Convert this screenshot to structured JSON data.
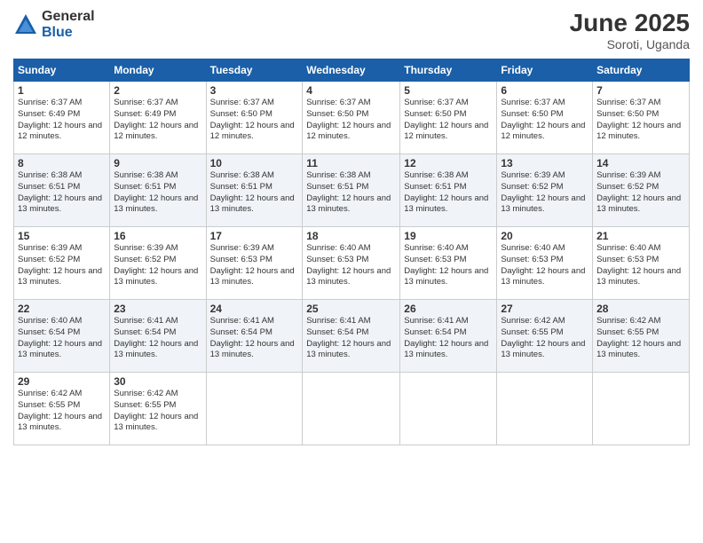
{
  "logo": {
    "general": "General",
    "blue": "Blue"
  },
  "title": {
    "month_year": "June 2025",
    "location": "Soroti, Uganda"
  },
  "weekdays": [
    "Sunday",
    "Monday",
    "Tuesday",
    "Wednesday",
    "Thursday",
    "Friday",
    "Saturday"
  ],
  "weeks": [
    [
      {
        "day": "1",
        "sunrise": "6:37 AM",
        "sunset": "6:49 PM",
        "daylight": "12 hours and 12 minutes."
      },
      {
        "day": "2",
        "sunrise": "6:37 AM",
        "sunset": "6:49 PM",
        "daylight": "12 hours and 12 minutes."
      },
      {
        "day": "3",
        "sunrise": "6:37 AM",
        "sunset": "6:50 PM",
        "daylight": "12 hours and 12 minutes."
      },
      {
        "day": "4",
        "sunrise": "6:37 AM",
        "sunset": "6:50 PM",
        "daylight": "12 hours and 12 minutes."
      },
      {
        "day": "5",
        "sunrise": "6:37 AM",
        "sunset": "6:50 PM",
        "daylight": "12 hours and 12 minutes."
      },
      {
        "day": "6",
        "sunrise": "6:37 AM",
        "sunset": "6:50 PM",
        "daylight": "12 hours and 12 minutes."
      },
      {
        "day": "7",
        "sunrise": "6:37 AM",
        "sunset": "6:50 PM",
        "daylight": "12 hours and 12 minutes."
      }
    ],
    [
      {
        "day": "8",
        "sunrise": "6:38 AM",
        "sunset": "6:51 PM",
        "daylight": "12 hours and 13 minutes."
      },
      {
        "day": "9",
        "sunrise": "6:38 AM",
        "sunset": "6:51 PM",
        "daylight": "12 hours and 13 minutes."
      },
      {
        "day": "10",
        "sunrise": "6:38 AM",
        "sunset": "6:51 PM",
        "daylight": "12 hours and 13 minutes."
      },
      {
        "day": "11",
        "sunrise": "6:38 AM",
        "sunset": "6:51 PM",
        "daylight": "12 hours and 13 minutes."
      },
      {
        "day": "12",
        "sunrise": "6:38 AM",
        "sunset": "6:51 PM",
        "daylight": "12 hours and 13 minutes."
      },
      {
        "day": "13",
        "sunrise": "6:39 AM",
        "sunset": "6:52 PM",
        "daylight": "12 hours and 13 minutes."
      },
      {
        "day": "14",
        "sunrise": "6:39 AM",
        "sunset": "6:52 PM",
        "daylight": "12 hours and 13 minutes."
      }
    ],
    [
      {
        "day": "15",
        "sunrise": "6:39 AM",
        "sunset": "6:52 PM",
        "daylight": "12 hours and 13 minutes."
      },
      {
        "day": "16",
        "sunrise": "6:39 AM",
        "sunset": "6:52 PM",
        "daylight": "12 hours and 13 minutes."
      },
      {
        "day": "17",
        "sunrise": "6:39 AM",
        "sunset": "6:53 PM",
        "daylight": "12 hours and 13 minutes."
      },
      {
        "day": "18",
        "sunrise": "6:40 AM",
        "sunset": "6:53 PM",
        "daylight": "12 hours and 13 minutes."
      },
      {
        "day": "19",
        "sunrise": "6:40 AM",
        "sunset": "6:53 PM",
        "daylight": "12 hours and 13 minutes."
      },
      {
        "day": "20",
        "sunrise": "6:40 AM",
        "sunset": "6:53 PM",
        "daylight": "12 hours and 13 minutes."
      },
      {
        "day": "21",
        "sunrise": "6:40 AM",
        "sunset": "6:53 PM",
        "daylight": "12 hours and 13 minutes."
      }
    ],
    [
      {
        "day": "22",
        "sunrise": "6:40 AM",
        "sunset": "6:54 PM",
        "daylight": "12 hours and 13 minutes."
      },
      {
        "day": "23",
        "sunrise": "6:41 AM",
        "sunset": "6:54 PM",
        "daylight": "12 hours and 13 minutes."
      },
      {
        "day": "24",
        "sunrise": "6:41 AM",
        "sunset": "6:54 PM",
        "daylight": "12 hours and 13 minutes."
      },
      {
        "day": "25",
        "sunrise": "6:41 AM",
        "sunset": "6:54 PM",
        "daylight": "12 hours and 13 minutes."
      },
      {
        "day": "26",
        "sunrise": "6:41 AM",
        "sunset": "6:54 PM",
        "daylight": "12 hours and 13 minutes."
      },
      {
        "day": "27",
        "sunrise": "6:42 AM",
        "sunset": "6:55 PM",
        "daylight": "12 hours and 13 minutes."
      },
      {
        "day": "28",
        "sunrise": "6:42 AM",
        "sunset": "6:55 PM",
        "daylight": "12 hours and 13 minutes."
      }
    ],
    [
      {
        "day": "29",
        "sunrise": "6:42 AM",
        "sunset": "6:55 PM",
        "daylight": "12 hours and 13 minutes."
      },
      {
        "day": "30",
        "sunrise": "6:42 AM",
        "sunset": "6:55 PM",
        "daylight": "12 hours and 13 minutes."
      },
      null,
      null,
      null,
      null,
      null
    ]
  ]
}
